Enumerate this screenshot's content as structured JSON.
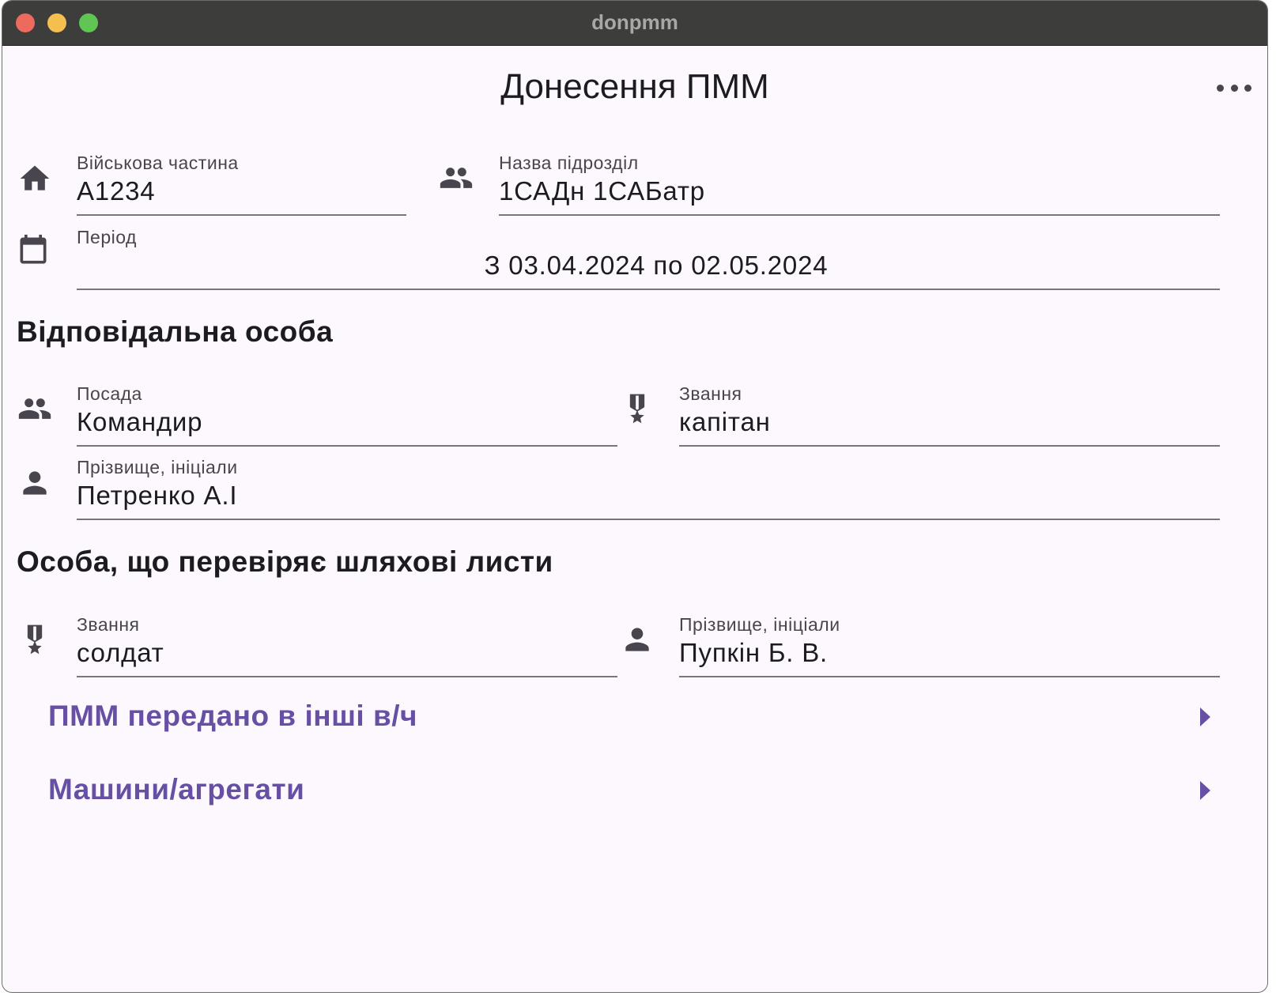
{
  "window": {
    "title": "donpmm"
  },
  "appbar": {
    "title": "Донесення ПММ",
    "more_icon": "more-horiz-icon"
  },
  "unit": {
    "military_unit": {
      "label": "Військова частина",
      "value": "А1234",
      "icon": "home-icon"
    },
    "subdivision": {
      "label": "Назва підрозділ",
      "value": "1САДн 1САБатр",
      "icon": "group-icon"
    },
    "period": {
      "label": "Період",
      "value": "З 03.04.2024 по 02.05.2024",
      "icon": "calendar-icon"
    }
  },
  "responsible": {
    "title": "Відповідальна особа",
    "position": {
      "label": "Посада",
      "value": "Командир",
      "icon": "group-icon"
    },
    "rank": {
      "label": "Звання",
      "value": "капітан",
      "icon": "military-medal-icon"
    },
    "name": {
      "label": "Прізвище, ініціали",
      "value": "Петренко А.І",
      "icon": "person-icon"
    }
  },
  "checker": {
    "title": "Особа, що перевіряє шляхові листи",
    "rank": {
      "label": "Звання",
      "value": "солдат",
      "icon": "military-medal-icon"
    },
    "name": {
      "label": "Прізвище, ініціали",
      "value": "Пупкін Б. В.",
      "icon": "person-icon"
    }
  },
  "nav": [
    {
      "label": "ПММ передано в інші в/ч",
      "icon": "arrow-right-icon"
    },
    {
      "label": "Машини/агрегати",
      "icon": "arrow-right-icon"
    }
  ],
  "colors": {
    "accent": "#6750a4",
    "background": "#fdf8fd",
    "titlebar": "#3d3e3c",
    "icon": "#49454f"
  }
}
